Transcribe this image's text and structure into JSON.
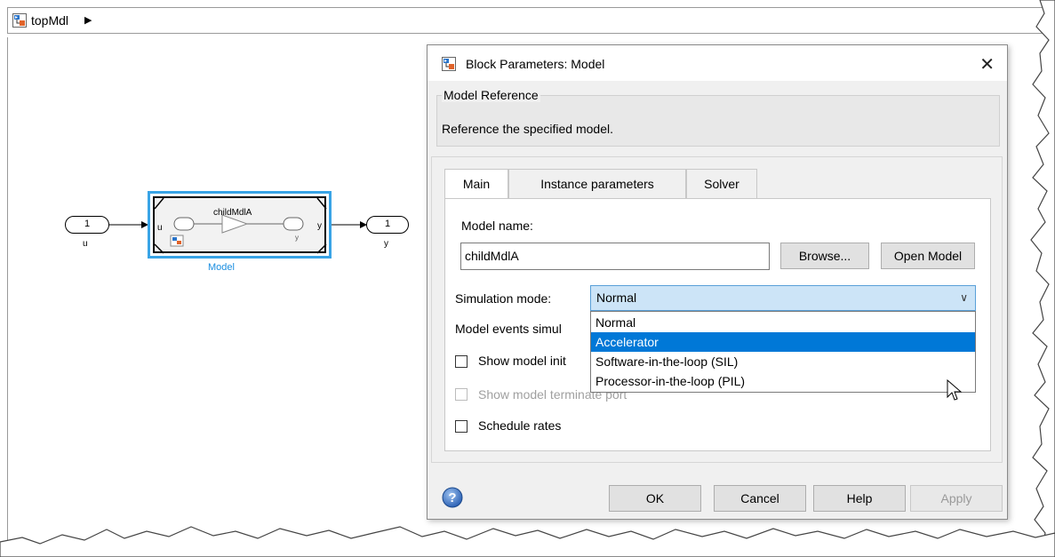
{
  "breadcrumb": {
    "model_name": "topMdl",
    "arrow": "▶"
  },
  "diagram": {
    "inport": {
      "number": "1",
      "label": "u"
    },
    "outport": {
      "number": "1",
      "label": "y"
    },
    "model_block": {
      "ref_name": "childMdlA",
      "in_port": "u",
      "out_port": "y",
      "inner_out": "y",
      "name": "Model"
    }
  },
  "dialog": {
    "title": "Block Parameters: Model",
    "close": "✕",
    "group_title": "Model Reference",
    "group_desc": "Reference the specified model.",
    "tabs": [
      {
        "label": "Main",
        "active": true
      },
      {
        "label": "Instance parameters",
        "active": false
      },
      {
        "label": "Solver",
        "active": false
      }
    ],
    "model_name_label": "Model name:",
    "model_name_value": "childMdlA",
    "browse_label": "Browse...",
    "open_model_label": "Open Model",
    "sim_mode_label": "Simulation mode:",
    "sim_mode_value": "Normal",
    "sim_mode_options": [
      "Normal",
      "Accelerator",
      "Software-in-the-loop (SIL)",
      "Processor-in-the-loop (PIL)"
    ],
    "sim_mode_highlighted": "Accelerator",
    "events_label": "Model events simul",
    "show_init_label": "Show model init",
    "show_term_label": "Show model terminate port",
    "schedule_label": "Schedule rates",
    "buttons": {
      "ok": "OK",
      "cancel": "Cancel",
      "help": "Help",
      "apply": "Apply"
    }
  },
  "icons": {
    "simulink": "simulink-model-icon",
    "help": "help-question-icon",
    "cursor": "mouse-cursor-icon",
    "chevron": "chevron-down-icon"
  }
}
